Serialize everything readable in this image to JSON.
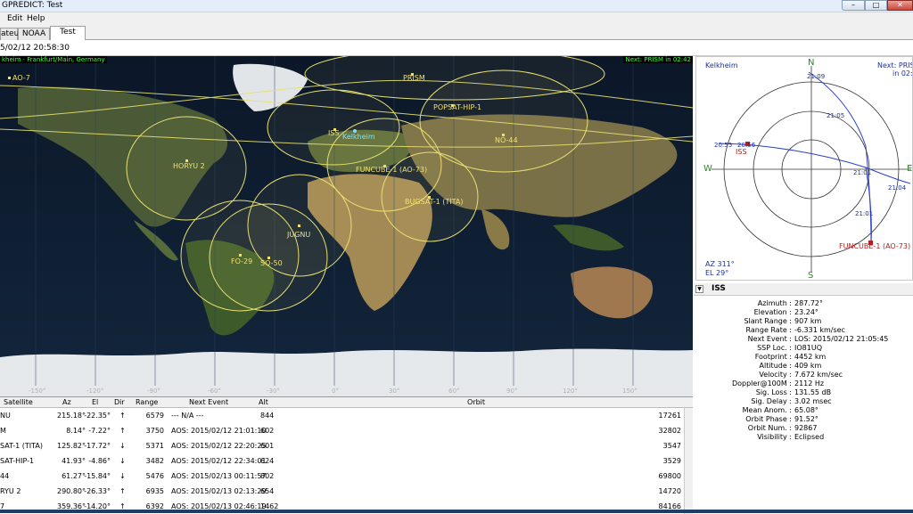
{
  "window": {
    "title": "GPREDICT: Test",
    "min": "–",
    "max": "□",
    "close": "✕"
  },
  "menu": [
    {
      "label": "Edit"
    },
    {
      "label": "Help"
    }
  ],
  "tabs": [
    {
      "label": "ateur"
    },
    {
      "label": "NOAA"
    },
    {
      "label": "Test"
    }
  ],
  "datetime": "5/02/12 20:58:30",
  "map": {
    "location": "kheim · Frankfurt/Main, Germany",
    "next": "Next: PRISM in 02:42",
    "qth": "Kelkheim",
    "satellites": [
      "AO-7",
      "PRISM",
      "POPSAT-HIP-1",
      "ISS",
      "NO-44",
      "FUNCUBE-1 (AO-73)",
      "BUGSAT-1 (TITA)",
      "HORYU 2",
      "JUGNU",
      "FO-29",
      "SO-50"
    ],
    "lon_ticks": [
      "-150°",
      "-120°",
      "-90°",
      "-60°",
      "-30°",
      "0°",
      "30°",
      "60°",
      "90°",
      "120°",
      "150°"
    ],
    "colors": {
      "footprint": "#e8e070",
      "label": "#f0e070",
      "qth": "#7be0ff",
      "header": "#40ff40"
    }
  },
  "polar": {
    "location": "Kelkheim",
    "next": "Next: PRISM",
    "next2": "in 02:40",
    "n": "N",
    "s": "S",
    "e": "E",
    "w": "W",
    "az": "AZ 311°",
    "el": "EL 29°",
    "iss_label": "ISS",
    "funcube_label": "FUNCUBE-1 (AO-73)",
    "time_labels": [
      "21:09",
      "21:05",
      "21:01",
      "20:55",
      "20:56",
      "21:04",
      "21:01"
    ]
  },
  "details": {
    "title": "ISS",
    "toggle": "▼",
    "rows": [
      {
        "k": "Azimuth :",
        "v": "287.72°"
      },
      {
        "k": "Elevation :",
        "v": "23.24°"
      },
      {
        "k": "Slant Range :",
        "v": "907 km"
      },
      {
        "k": "Range Rate :",
        "v": "-6.331 km/sec"
      },
      {
        "k": "Next Event :",
        "v": "LOS: 2015/02/12 21:05:45"
      },
      {
        "k": "SSP Loc. :",
        "v": "IO81UQ"
      },
      {
        "k": "Footprint :",
        "v": "4452 km"
      },
      {
        "k": "Altitude :",
        "v": "409 km"
      },
      {
        "k": "Velocity :",
        "v": "7.672 km/sec"
      },
      {
        "k": "Doppler@100M :",
        "v": "2112 Hz"
      },
      {
        "k": "Sig. Loss :",
        "v": "131.55 dB"
      },
      {
        "k": "Sig. Delay :",
        "v": "3.02 msec"
      },
      {
        "k": "Mean Anom. :",
        "v": "65.08°"
      },
      {
        "k": "Orbit Phase :",
        "v": "91.52°"
      },
      {
        "k": "Orbit Num. :",
        "v": "92867"
      },
      {
        "k": "Visibility :",
        "v": "Eclipsed"
      }
    ]
  },
  "table": {
    "headers": [
      "Satellite",
      "Az",
      "El",
      "Dir",
      "Range",
      "Next Event",
      "Alt",
      "Orbit"
    ],
    "rows": [
      {
        "sat": "NU",
        "az": "215.18°",
        "el": "-22.35°",
        "dir": "↑",
        "range": "6579",
        "event": "--- N/A ---",
        "alt": "844",
        "orbit": "17261"
      },
      {
        "sat": "M",
        "az": "8.14°",
        "el": "-7.22°",
        "dir": "↑",
        "range": "3750",
        "event": "AOS: 2015/02/12 21:01:10",
        "alt": "602",
        "orbit": "32802"
      },
      {
        "sat": "SAT-1 (TITA)",
        "az": "125.82°",
        "el": "-17.72°",
        "dir": "↓",
        "range": "5371",
        "event": "AOS: 2015/02/12 22:20:25",
        "alt": "601",
        "orbit": "3547"
      },
      {
        "sat": "SAT-HIP-1",
        "az": "41.93°",
        "el": "-4.86°",
        "dir": "↓",
        "range": "3482",
        "event": "AOS: 2015/02/12 22:34:01",
        "alt": "624",
        "orbit": "3529"
      },
      {
        "sat": "44",
        "az": "61.27°",
        "el": "-15.84°",
        "dir": "↓",
        "range": "5476",
        "event": "AOS: 2015/02/13 00:11:57",
        "alt": "802",
        "orbit": "69800"
      },
      {
        "sat": "RYU 2",
        "az": "290.80°",
        "el": "-26.33°",
        "dir": "↑",
        "range": "6935",
        "event": "AOS: 2015/02/13 02:13:29",
        "alt": "654",
        "orbit": "14720"
      },
      {
        "sat": "7",
        "az": "359.36°",
        "el": "-14.20°",
        "dir": "↑",
        "range": "6392",
        "event": "AOS: 2015/02/13 02:46:19",
        "alt": "1462",
        "orbit": "84166"
      }
    ]
  }
}
